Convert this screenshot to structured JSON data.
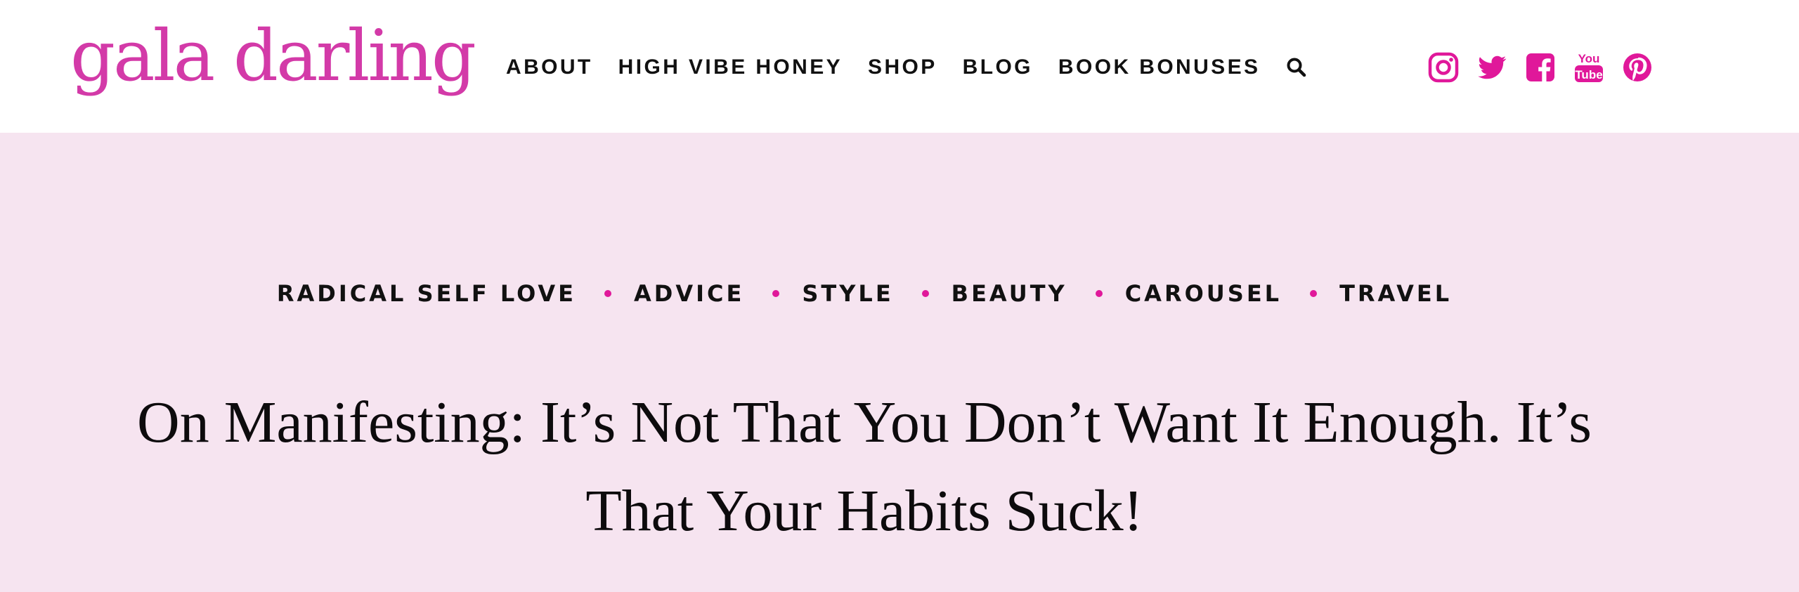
{
  "colors": {
    "brand_pink": "#d33aa8",
    "icon_pink": "#e0189a",
    "hero_bg": "#f6e4f0",
    "text_dark": "#111111"
  },
  "header": {
    "logo_text": "gala darling",
    "nav": [
      {
        "label": "ABOUT"
      },
      {
        "label": "HIGH VIBE HONEY"
      },
      {
        "label": "SHOP"
      },
      {
        "label": "BLOG"
      },
      {
        "label": "BOOK BONUSES"
      }
    ],
    "search_icon": "search-icon",
    "social": [
      {
        "icon": "instagram-icon"
      },
      {
        "icon": "twitter-icon"
      },
      {
        "icon": "facebook-icon"
      },
      {
        "icon": "youtube-icon",
        "text_top": "You",
        "text_bottom": "Tube"
      },
      {
        "icon": "pinterest-icon"
      }
    ]
  },
  "hero": {
    "categories": [
      {
        "label": "RADICAL SELF LOVE"
      },
      {
        "label": "ADVICE"
      },
      {
        "label": "STYLE"
      },
      {
        "label": "BEAUTY"
      },
      {
        "label": "CAROUSEL"
      },
      {
        "label": "TRAVEL"
      }
    ],
    "title": "On Manifesting: It’s Not That You Don’t Want It Enough. It’s That Your Habits Suck!"
  }
}
